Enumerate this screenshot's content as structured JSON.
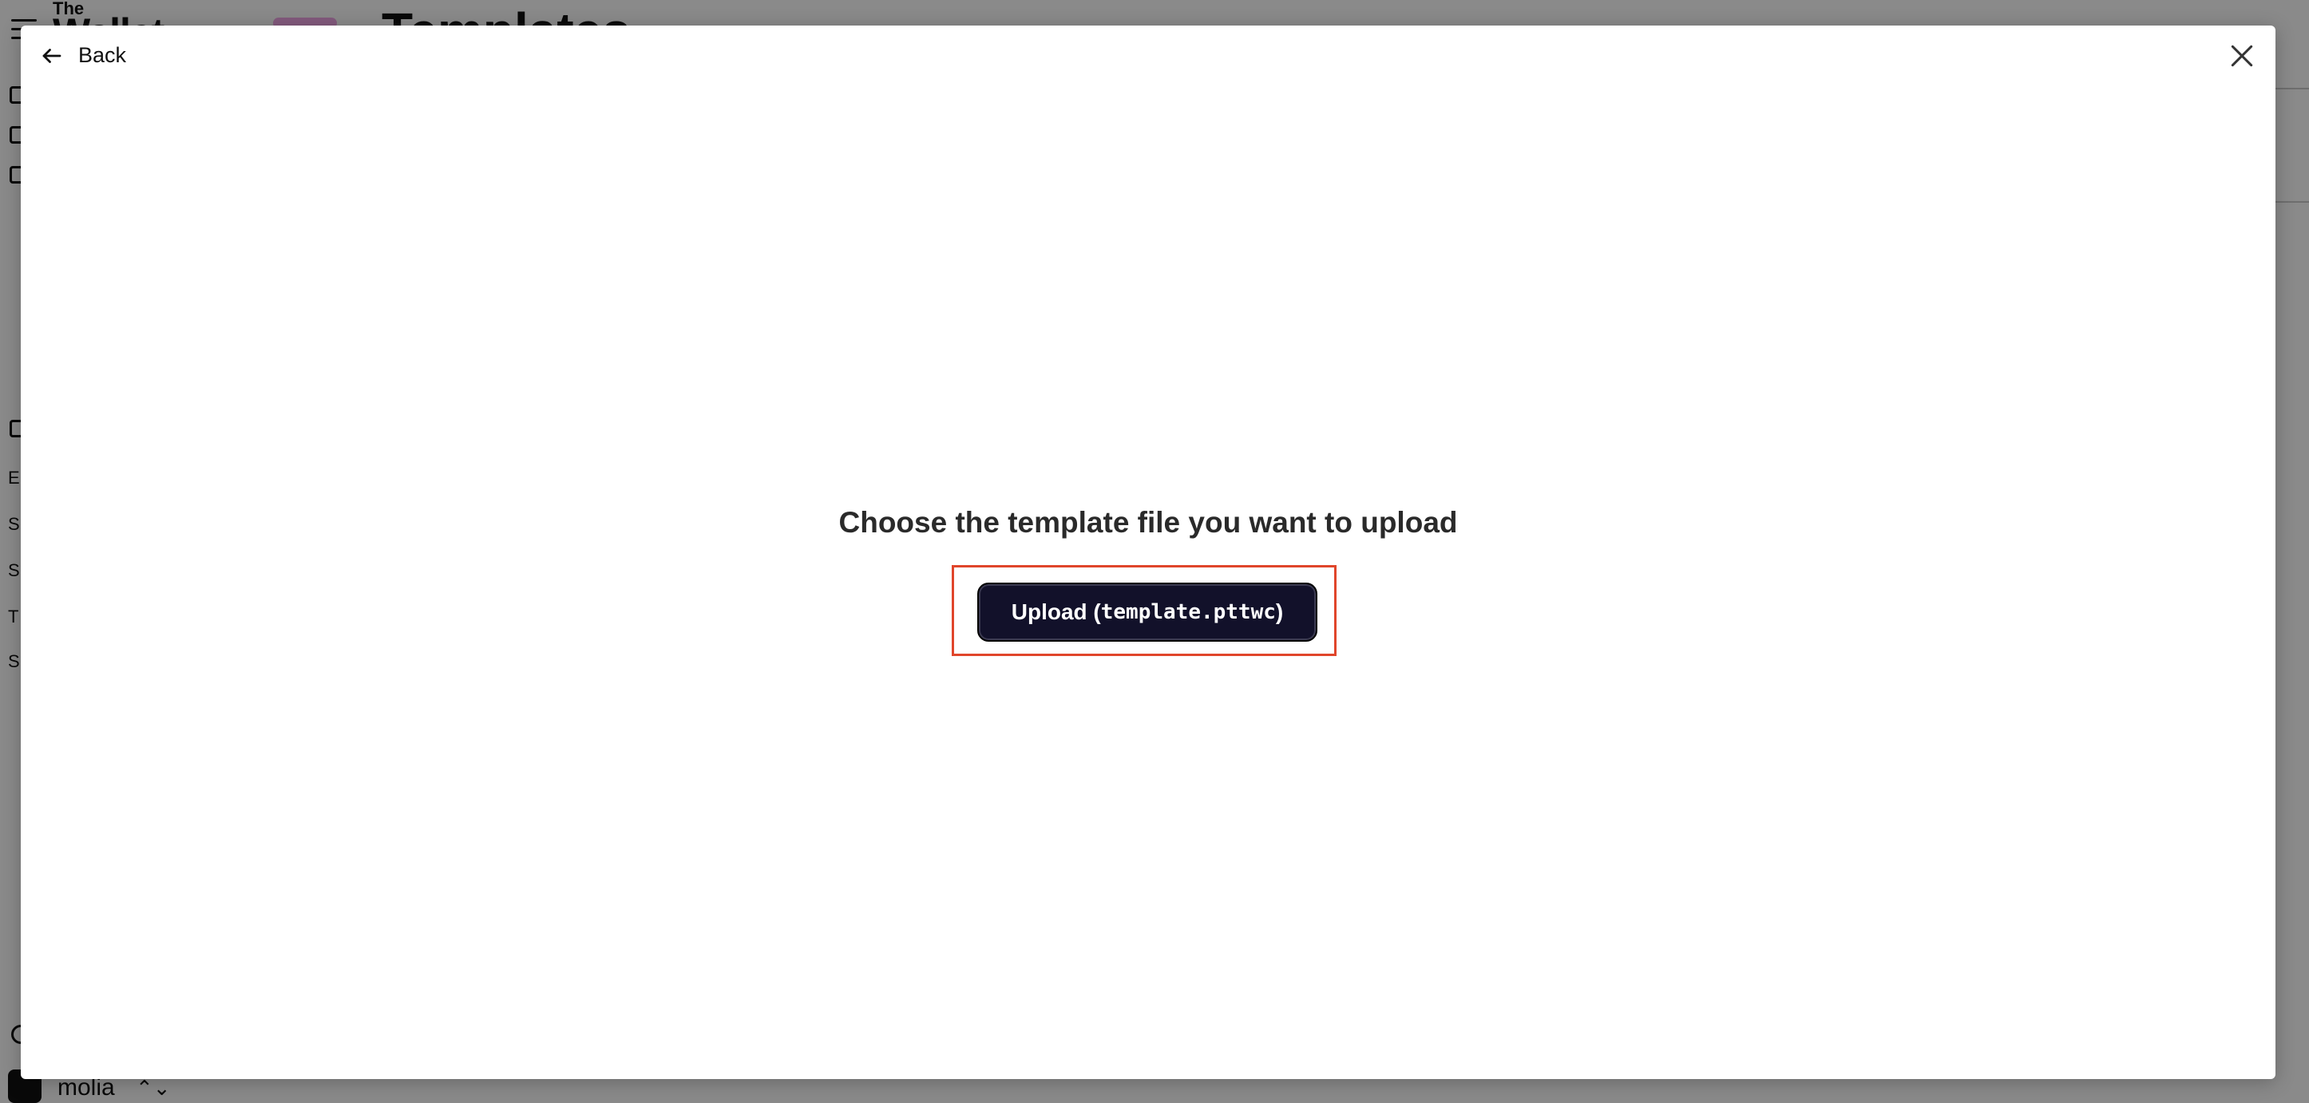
{
  "background_app": {
    "logo_small": "The",
    "logo_brand": "Wallet",
    "page_title": "Templates",
    "sidebar_letters": [
      "E",
      "S",
      "S",
      "T",
      "S"
    ],
    "workspace_name": "molia",
    "workspace_chevron": "⌃⌄"
  },
  "modal": {
    "back_label": "Back",
    "prompt": "Choose the template file you want to upload",
    "upload_prefix": "Upload (",
    "upload_filename": "template.pttwc",
    "upload_suffix": ")"
  },
  "colors": {
    "button_bg": "#12112a",
    "highlight_border": "#e0452b",
    "overlay": "rgba(0,0,0,0.46)"
  },
  "icons": {
    "back": "arrow-left-icon",
    "close": "close-icon"
  }
}
